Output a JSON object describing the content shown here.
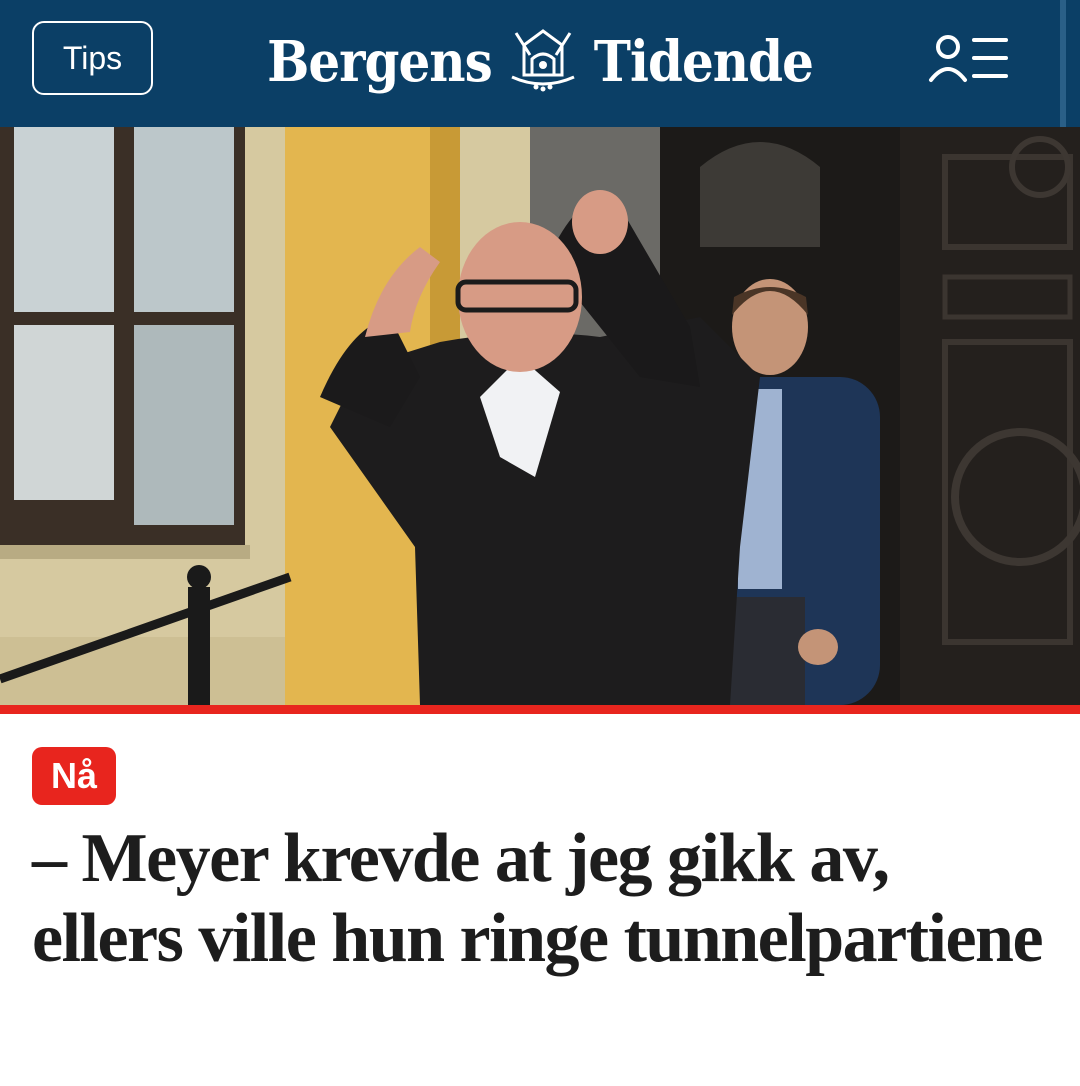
{
  "header": {
    "tips_label": "Tips",
    "logo_left": "Bergens",
    "logo_right": "Tidende",
    "background_color": "#0b3f66"
  },
  "hero_image": {
    "icons": [
      "crest-icon",
      "user-menu-icon"
    ]
  },
  "article": {
    "badge": "Nå",
    "headline": "– Meyer krevde at jeg gikk av, ellers ville hun ringe tunnelpartiene",
    "accent_color": "#e8251e"
  }
}
